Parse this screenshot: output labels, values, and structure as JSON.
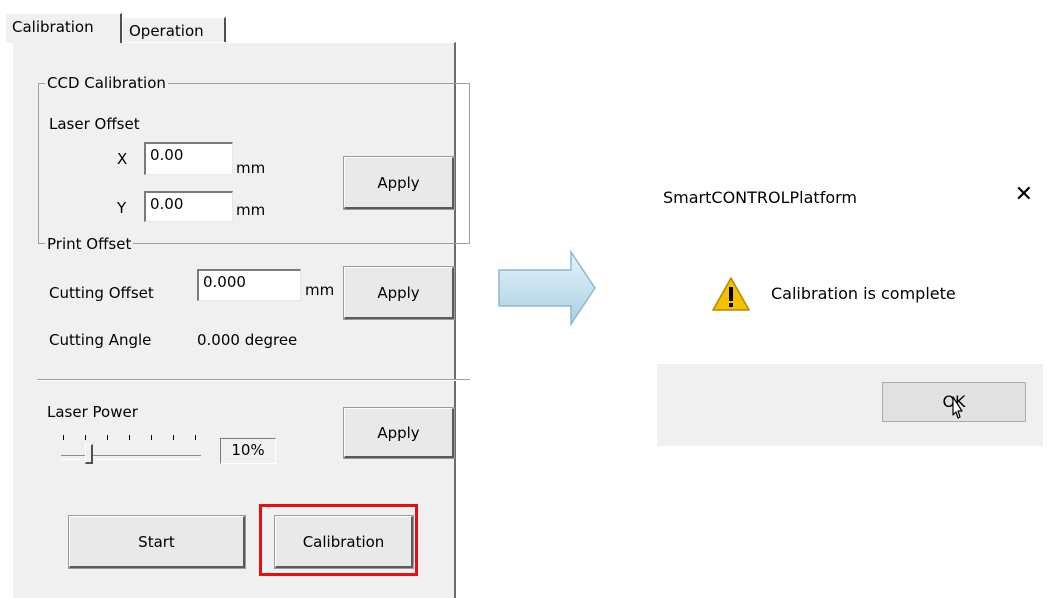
{
  "tabs": {
    "calibration": "Calibration",
    "operation": "Operation"
  },
  "ccd": {
    "title": "CCD Calibration",
    "laser_offset_label": "Laser Offset",
    "x_label": "X",
    "x_value": "0.00",
    "x_unit": "mm",
    "y_label": "Y",
    "y_value": "0.00",
    "y_unit": "mm",
    "apply_label": "Apply"
  },
  "print_offset": {
    "title": "Print Offset",
    "cutting_offset_label": "Cutting Offset",
    "cutting_offset_value": "0.000",
    "cutting_offset_unit": "mm",
    "apply_label": "Apply",
    "cutting_angle_label": "Cutting Angle",
    "cutting_angle_value": "0.000 degree"
  },
  "laser_power": {
    "label": "Laser Power",
    "percent_text": "10%",
    "level": 0.1,
    "apply_label": "Apply"
  },
  "actions": {
    "start_label": "Start",
    "calibration_label": "Calibration"
  },
  "dialog": {
    "title": "SmartCONTROLPlatform",
    "close_glyph": "✕",
    "message": "Calibration is complete",
    "ok_label": "OK"
  },
  "colors": {
    "highlight": "#e61010",
    "arrow": "#c9e6f3",
    "warning": "#f2c200"
  }
}
